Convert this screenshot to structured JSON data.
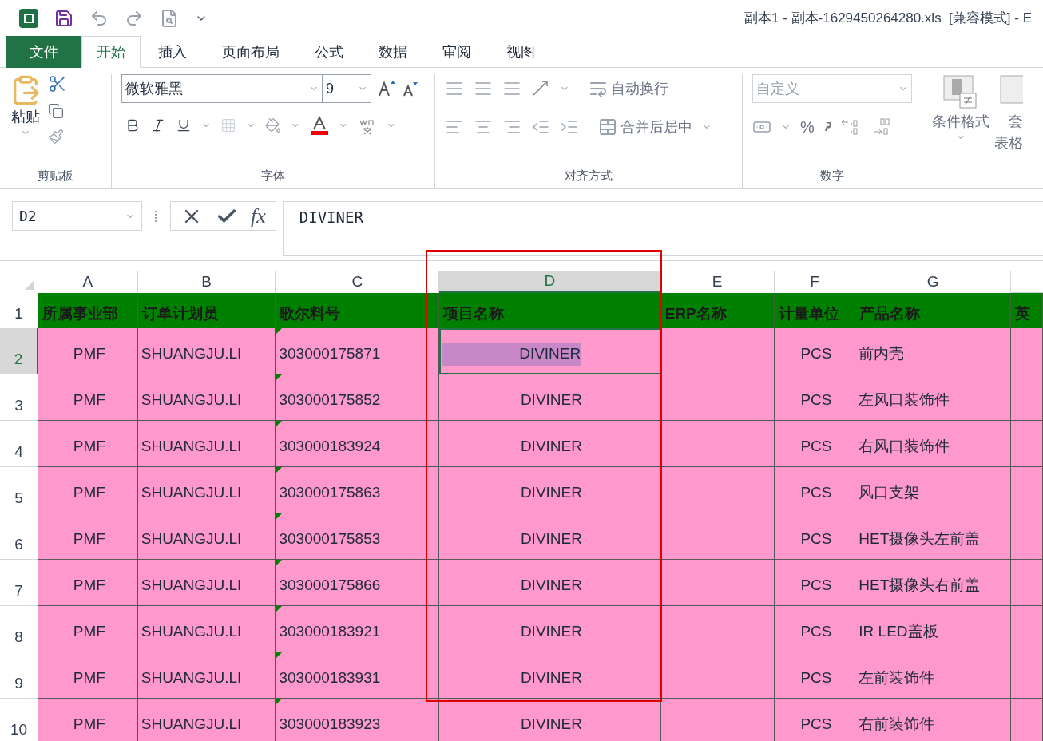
{
  "window": {
    "title": "副本1 - 副本-1629450264280.xls  [兼容模式] - E"
  },
  "menu_tabs": [
    {
      "label": "文件",
      "kind": "file",
      "selected": false
    },
    {
      "label": "开始",
      "kind": "tab",
      "selected": true
    },
    {
      "label": "插入",
      "kind": "tab",
      "selected": false
    },
    {
      "label": "页面布局",
      "kind": "tab",
      "selected": false
    },
    {
      "label": "公式",
      "kind": "tab",
      "selected": false
    },
    {
      "label": "数据",
      "kind": "tab",
      "selected": false
    },
    {
      "label": "审阅",
      "kind": "tab",
      "selected": false
    },
    {
      "label": "视图",
      "kind": "tab",
      "selected": false
    }
  ],
  "ribbon": {
    "clipboard": {
      "paste": "粘贴",
      "group_label": "剪贴板"
    },
    "font": {
      "name": "微软雅黑",
      "size": "9",
      "group_label": "字体"
    },
    "alignment": {
      "wrap_text": "自动换行",
      "merge_center": "合并后居中",
      "group_label": "对齐方式"
    },
    "number": {
      "format": "自定义",
      "percent": "%",
      "group_label": "数字"
    },
    "styles": {
      "conditional_format": "条件格式",
      "table_format_top": "套",
      "table_format_bottom": "表格"
    }
  },
  "formula_bar": {
    "name_box": "D2",
    "fx": "fx",
    "value": "DIVINER"
  },
  "sheet": {
    "columns": [
      {
        "label": "A",
        "selected": false,
        "flagged": false
      },
      {
        "label": "B",
        "selected": false,
        "flagged": false
      },
      {
        "label": "C",
        "selected": false,
        "flagged": true
      },
      {
        "label": "D",
        "selected": true,
        "flagged": false
      },
      {
        "label": "E",
        "selected": false,
        "flagged": false
      },
      {
        "label": "F",
        "selected": false,
        "flagged": false
      },
      {
        "label": "G",
        "selected": false,
        "flagged": false
      }
    ],
    "header_row": {
      "number": "1",
      "cells": [
        "所属事业部",
        "订单计划员",
        "歌尔料号",
        "项目名称",
        "ERP名称",
        "计量单位",
        "产品名称",
        "英"
      ]
    },
    "rows": [
      {
        "number": "2",
        "selected": true,
        "cells": [
          "PMF",
          "SHUANGJU.LI",
          "303000175871",
          "DIVINER",
          "",
          "PCS",
          "前内壳"
        ]
      },
      {
        "number": "3",
        "selected": false,
        "cells": [
          "PMF",
          "SHUANGJU.LI",
          "303000175852",
          "DIVINER",
          "",
          "PCS",
          "左风口装饰件"
        ]
      },
      {
        "number": "4",
        "selected": false,
        "cells": [
          "PMF",
          "SHUANGJU.LI",
          "303000183924",
          "DIVINER",
          "",
          "PCS",
          "右风口装饰件"
        ]
      },
      {
        "number": "5",
        "selected": false,
        "cells": [
          "PMF",
          "SHUANGJU.LI",
          "303000175863",
          "DIVINER",
          "",
          "PCS",
          "风口支架"
        ]
      },
      {
        "number": "6",
        "selected": false,
        "cells": [
          "PMF",
          "SHUANGJU.LI",
          "303000175853",
          "DIVINER",
          "",
          "PCS",
          "HET摄像头左前盖"
        ]
      },
      {
        "number": "7",
        "selected": false,
        "cells": [
          "PMF",
          "SHUANGJU.LI",
          "303000175866",
          "DIVINER",
          "",
          "PCS",
          "HET摄像头右前盖"
        ]
      },
      {
        "number": "8",
        "selected": false,
        "cells": [
          "PMF",
          "SHUANGJU.LI",
          "303000183921",
          "DIVINER",
          "",
          "PCS",
          "IR LED盖板"
        ]
      },
      {
        "number": "9",
        "selected": false,
        "cells": [
          "PMF",
          "SHUANGJU.LI",
          "303000183931",
          "DIVINER",
          "",
          "PCS",
          "左前装饰件"
        ]
      },
      {
        "number": "10",
        "selected": false,
        "cells": [
          "PMF",
          "SHUANGJU.LI",
          "303000183923",
          "DIVINER",
          "",
          "PCS",
          "右前装饰件"
        ]
      }
    ]
  }
}
